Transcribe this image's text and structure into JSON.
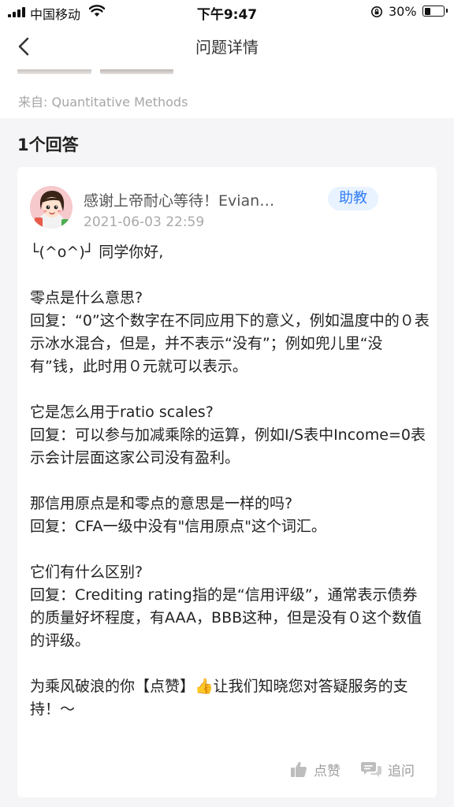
{
  "status_bar": {
    "carrier": "中国移动",
    "time": "下午9:47",
    "battery": "30%"
  },
  "nav": {
    "title": "问题详情"
  },
  "question": {
    "source": "来自: Quantitative Methods"
  },
  "answers": {
    "header": "1个回答",
    "items": [
      {
        "author": "感谢上帝耐心等待！Evian…",
        "role": "助教",
        "time": "2021-06-03 22:59",
        "paragraphs": [
          "└(^o^)┘ 同学你好,",
          "零点是什么意思?\n回复：“0”这个数字在不同应用下的意义，例如温度中的０表示冰水混合，但是，并不表示“没有”；例如兜儿里“没有”钱，此时用０元就可以表示。",
          "它是怎么用于ratio scales?\n回复：可以参与加减乘除的运算，例如I/S表中Income=0表示会计层面这家公司没有盈利。",
          "那信用原点是和零点的意思是一样的吗?\n回复：CFA一级中没有\"信用原点\"这个词汇。",
          "它们有什么区别?\n回复：Crediting rating指的是“信用评级”，通常表示债券的质量好坏程度，有AAA，BBB这种，但是没有０这个数值的评级。",
          "为乘风破浪的你【点赞】👍让我们知晓您对答疑服务的支持！～"
        ],
        "actions": {
          "like": "点赞",
          "followup": "追问"
        }
      }
    ]
  },
  "colors": {
    "accent": "#2f7cf6",
    "badge_bg": "#e9f2ff",
    "page_bg": "#f5f5f7",
    "muted_text": "#a6a6a6"
  },
  "icons": {
    "back": "chevron-left-icon",
    "like": "thumbs-up-icon",
    "followup": "chat-bubbles-icon"
  }
}
